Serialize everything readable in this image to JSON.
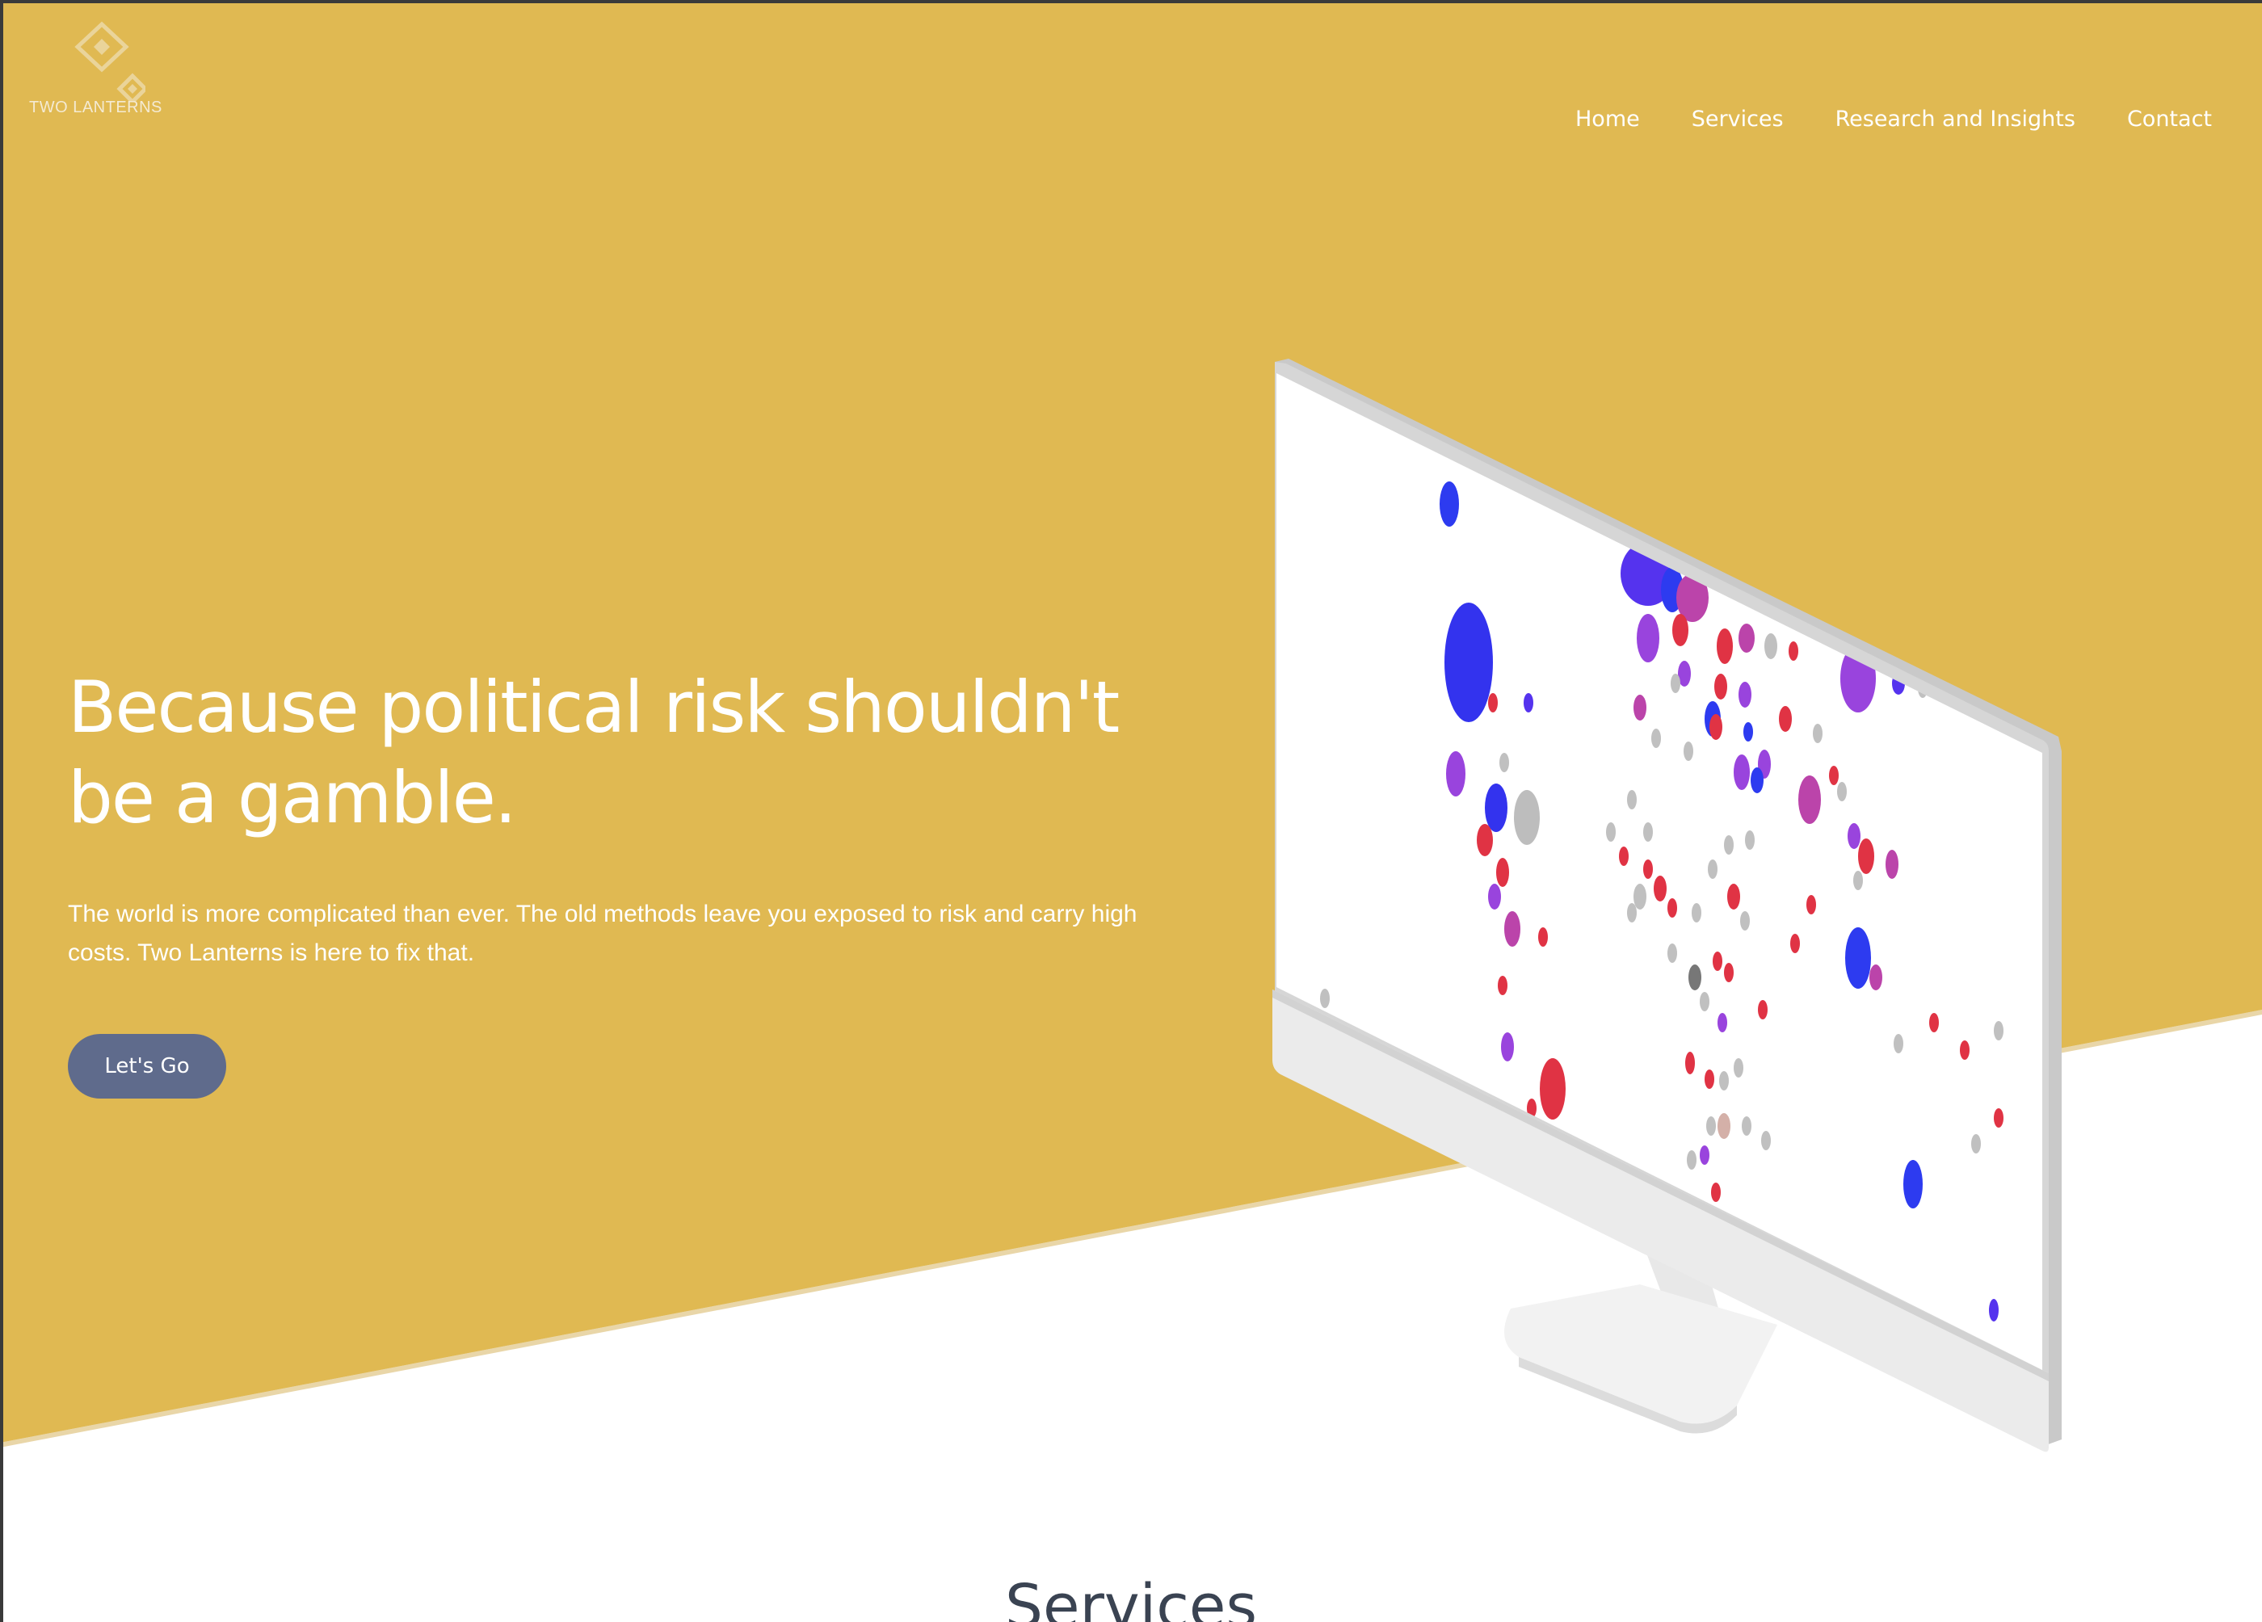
{
  "brand": {
    "name": "TWO LANTERNS",
    "accent_color": "#E0B952",
    "button_color": "#5F6B8C"
  },
  "nav": {
    "items": [
      "Home",
      "Services",
      "Research and Insights",
      "Contact"
    ]
  },
  "hero": {
    "title": "Because political risk shouldn't be a gamble.",
    "subtitle": "The world is more complicated than ever. The old methods leave you exposed to risk and carry high costs. Two Lanterns is here to fix that.",
    "cta_label": "Let's Go",
    "illustration": "monitor-with-bubble-map",
    "bubble_colors": [
      "#3333EE",
      "#9944DD",
      "#E03344",
      "#C0C0C0",
      "#BB44AA"
    ]
  },
  "services": {
    "heading": "Services"
  }
}
